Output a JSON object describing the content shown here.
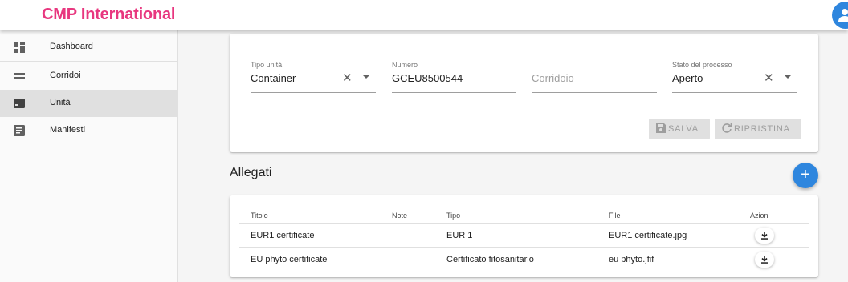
{
  "app": {
    "title": "CMP International"
  },
  "sidebar": {
    "items": [
      {
        "label": "Dashboard",
        "icon": "dashboard-icon",
        "active": false
      },
      {
        "label": "Corridoi",
        "icon": "corridor-icon",
        "active": false
      },
      {
        "label": "Unità",
        "icon": "unit-icon",
        "active": true
      },
      {
        "label": "Manifesti",
        "icon": "document-icon",
        "active": false
      }
    ]
  },
  "filters": {
    "tipo_unita": {
      "label": "Tipo unità",
      "value": "Container"
    },
    "numero": {
      "label": "Numero",
      "value": "GCEU8500544"
    },
    "corridoio": {
      "placeholder": "Corridoio"
    },
    "stato": {
      "label": "Stato del processo",
      "value": "Aperto"
    },
    "clear_symbol": "✕"
  },
  "actions": {
    "save_label": "SALVA",
    "reset_label": "RIPRISTINA"
  },
  "attachments": {
    "title": "Allegati",
    "add_label": "+",
    "columns": [
      "Titolo",
      "Note",
      "Tipo",
      "File",
      "Azioni"
    ],
    "rows": [
      {
        "titolo": "EUR1 certificate",
        "note": "",
        "tipo": "EUR 1",
        "file": "EUR1 certificate.jpg"
      },
      {
        "titolo": "EU phyto certificate",
        "note": "",
        "tipo": "Certificato fitosanitario",
        "file": "eu phyto.jfif"
      }
    ]
  },
  "colors": {
    "brand": "#e8377f",
    "accent": "#2e86de",
    "disabled": "#e0e0e0"
  }
}
